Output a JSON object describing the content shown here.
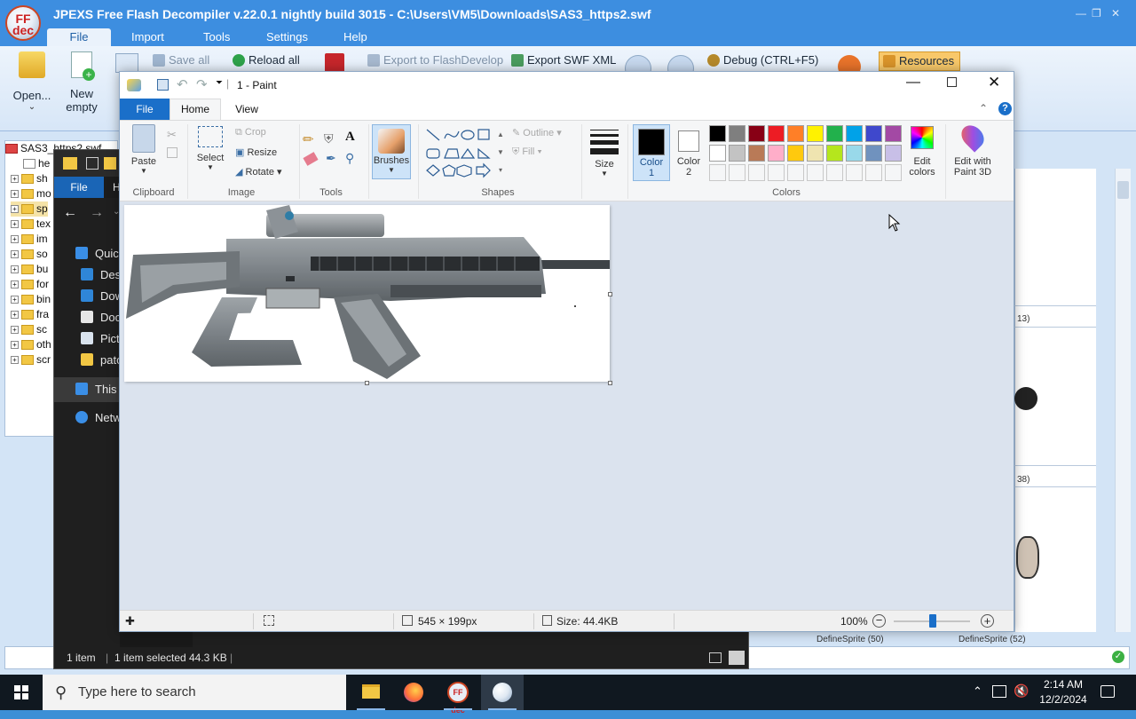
{
  "ffdec": {
    "title": "JPEXS Free Flash Decompiler v.22.0.1 nightly build 3015 - C:\\Users\\VM5\\Downloads\\SAS3_https2.swf",
    "logo_text": "FF dec",
    "menu": [
      "File",
      "Import",
      "Tools",
      "Settings",
      "Help"
    ],
    "ribbon": {
      "open_label": "Open...",
      "new_label": "New",
      "new_label2": "empty",
      "save_all": "Save all",
      "reload_all": "Reload all",
      "export_flashdevelop": "Export to FlashDevelop",
      "export_swf_xml": "Export SWF XML",
      "debug": "Debug (CTRL+F5)",
      "resources": "Resources"
    },
    "tree": {
      "root": "SAS3_https2.swf",
      "items": [
        "he",
        "sh",
        "mo",
        "sp",
        "tex",
        "im",
        "so",
        "bu",
        "for",
        "bin",
        "fra",
        "sc",
        "oth",
        "scr"
      ]
    },
    "right_panel": {
      "label_13": "13)",
      "label_38": "38)",
      "define_50": "DefineSprite (50)",
      "define_52": "DefineSprite (52)"
    }
  },
  "explorer": {
    "file_tab": "File",
    "tab2": "H",
    "nav_items": [
      {
        "label": "Quick",
        "color": "#3a8ee6"
      },
      {
        "label": "Desk",
        "color": "#2f86d8"
      },
      {
        "label": "Dow",
        "color": "#2f86d8"
      },
      {
        "label": "Doc",
        "color": "#e6e6e6"
      },
      {
        "label": "Pict",
        "color": "#d9e3ee"
      },
      {
        "label": "pato",
        "color": "#f2c744"
      },
      {
        "label": "This P",
        "color": "#3a8ee6"
      },
      {
        "label": "Netw",
        "color": "#3a8ee6"
      }
    ],
    "status": {
      "count": "1 item",
      "selected": "1 item selected",
      "size": "44.3 KB"
    }
  },
  "paint": {
    "title": "1 - Paint",
    "tabs": {
      "file": "File",
      "home": "Home",
      "view": "View"
    },
    "clipboard": {
      "paste": "Paste",
      "group": "Clipboard"
    },
    "image": {
      "select": "Select",
      "crop": "Crop",
      "resize": "Resize",
      "rotate": "Rotate",
      "group": "Image"
    },
    "tools": {
      "group": "Tools"
    },
    "brushes": {
      "label": "Brushes"
    },
    "shapes": {
      "outline": "Outline",
      "fill": "Fill",
      "group": "Shapes"
    },
    "size": {
      "label": "Size"
    },
    "color1": {
      "label": "Color",
      "num": "1"
    },
    "color2": {
      "label": "Color",
      "num": "2"
    },
    "colors_group": "Colors",
    "edit_colors": {
      "line1": "Edit",
      "line2": "colors"
    },
    "paint3d": {
      "line1": "Edit with",
      "line2": "Paint 3D"
    },
    "palette_row1": [
      "#000000",
      "#7f7f7f",
      "#880015",
      "#ed1c24",
      "#ff7f27",
      "#fff200",
      "#22b14c",
      "#00a2e8",
      "#3f48cc",
      "#a349a4"
    ],
    "palette_row2": [
      "#ffffff",
      "#c3c3c3",
      "#b97a57",
      "#ffaec9",
      "#ffc90e",
      "#efe4b0",
      "#b5e61d",
      "#99d9ea",
      "#7092be",
      "#c8bfe7"
    ],
    "status": {
      "dimensions": "545 × 199px",
      "filesize": "Size: 44.4KB",
      "zoom": "100%"
    }
  },
  "taskbar": {
    "search_placeholder": "Type here to search",
    "time": "2:14 AM",
    "date": "12/2/2024"
  }
}
